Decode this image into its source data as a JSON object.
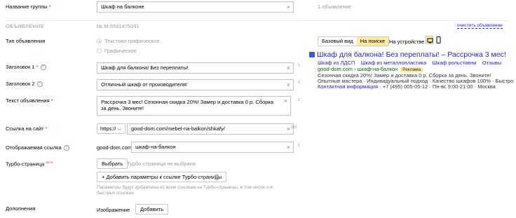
{
  "group": {
    "label": "Название группы",
    "required": "*",
    "value": "Шкаф на балконе",
    "count_text": "1 объявление"
  },
  "ad_section": {
    "header": "ОБЪЯВЛЕНИЕ",
    "number": "№ M-5591475091",
    "clear_link": "очистить объявление"
  },
  "ad_type": {
    "label": "Тип объявления",
    "options": [
      "Текстово-графическое",
      "Графическое"
    ],
    "selected": "Текстово-графическое"
  },
  "title1": {
    "label": "Заголовок 1",
    "required": "*",
    "value": "Шкаф для балкона! Без переплаты!",
    "counter": "5"
  },
  "title2": {
    "label": "Заголовок 2",
    "value": "Отличный шкаф от производителя!",
    "counter": "0"
  },
  "ad_text": {
    "label": "Текст объявления",
    "required": "*",
    "value": "Рассрочка 3 мес! Сезонная скидка 20%! Замер и доставка 0 р. Сборка за день. Звоните!",
    "counter": "2"
  },
  "link": {
    "label": "Ссылка на сайт",
    "required": "*",
    "protocol": "https://",
    "value": "good-dom.com/mebel-na-balkon/shkafy/",
    "counter": "900"
  },
  "display_link": {
    "label": "Отображаемая ссылка",
    "domain": "good-dom.com/",
    "value": "шкаф-на-балкон",
    "counter": "6"
  },
  "turbo": {
    "label": "Турбо-страница",
    "badge": "BETA",
    "button": "Выбрать",
    "status": "Турбо-страница не выбрана",
    "add_params_button": "Добавить параметры к ссылке Турбо-страницы",
    "hint_line1": "Параметры будут добавлены ко всем ссылкам на Турбо-страницы, в том числе и в",
    "hint_line2": "быстрых ссылках."
  },
  "extras": {
    "label": "Дополнения",
    "image_label": "Изображение",
    "add_button": "Добавить"
  },
  "preview": {
    "tabs": [
      "Базовый вид",
      "На поиске"
    ],
    "active_tab": "На поиске",
    "device_label": "На устройстве",
    "title": "Шкаф для балкона! Без переплаты! – Рассрочка 3 мес!",
    "sitelinks": [
      "Шкаф из ЛДСП",
      "Шкаф из металлопластика",
      "Шкаф рольставни",
      "Отзывы"
    ],
    "url": "good-dom.com › шкаф-на-балкон",
    "badge": "Реклама",
    "text": "Сезонная скидка 20%! Замер и доставка 0 р. Сборка за день. Звоните!",
    "callouts": "Опытные мастера · Индивидуальный подход · Качество шкафов 100% · Быстро",
    "contact_link": "Контактная информация",
    "contact_rest": " · +7 (495) 005-05-12 · Пн-вс 9:00-21:00 · Москва"
  },
  "colors": {
    "accent": "#ffeba0",
    "link": "#2222cc",
    "url_green": "#006600",
    "required": "#e31b1b"
  }
}
